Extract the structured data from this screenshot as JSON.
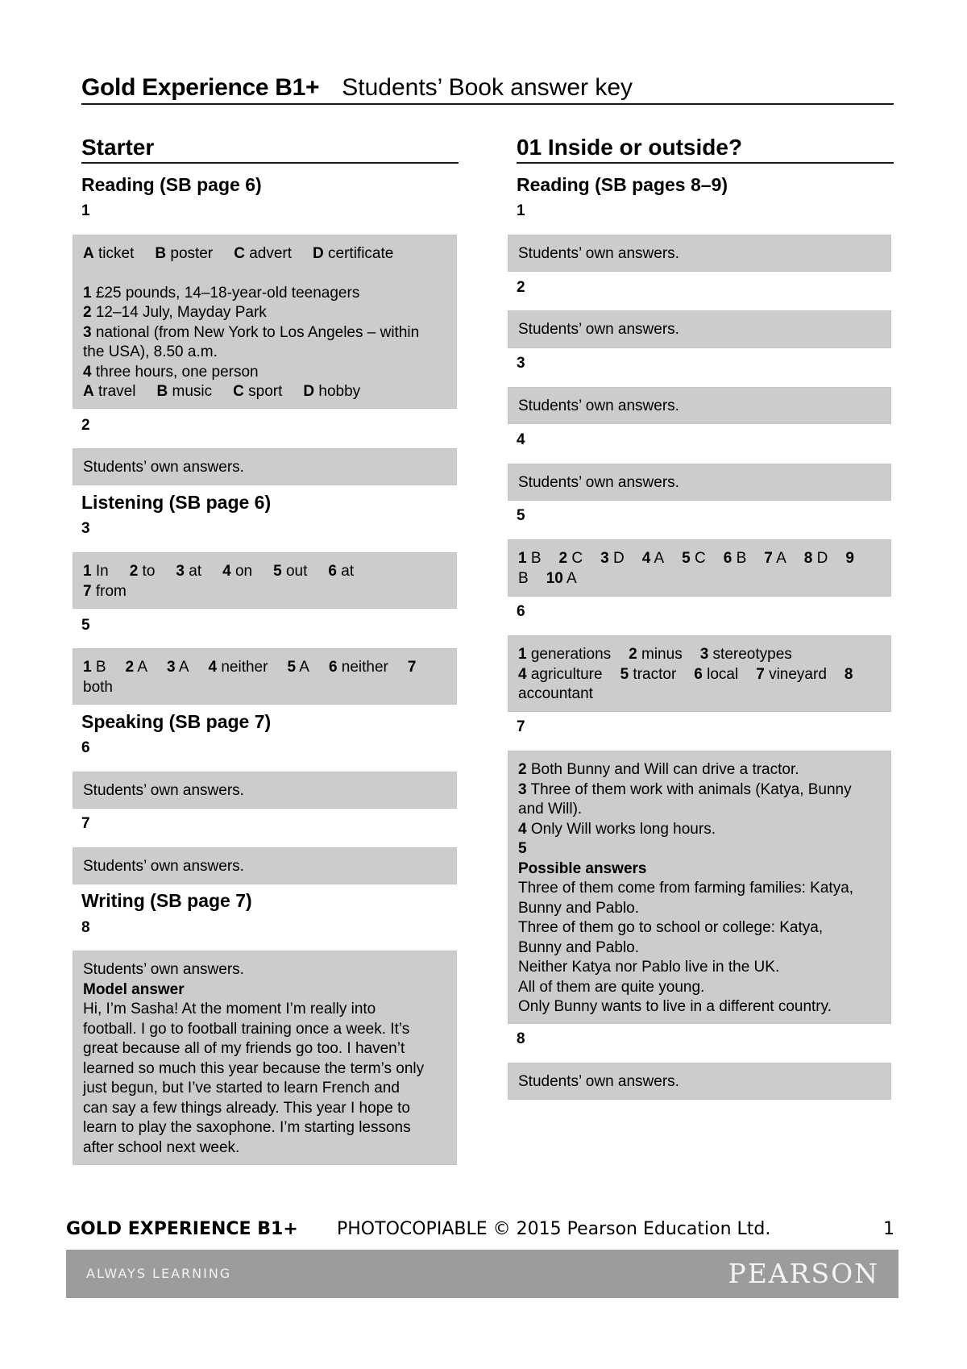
{
  "header": {
    "book": "Gold Experience B1+",
    "doc": "Students’ Book answer key"
  },
  "left": {
    "section": "Starter",
    "reading": {
      "title": "Reading (SB page 6)",
      "q1": {
        "num": "1",
        "row1": [
          [
            "A",
            "ticket"
          ],
          [
            "B",
            "poster"
          ],
          [
            "C",
            "advert"
          ],
          [
            "D",
            "certificate"
          ]
        ],
        "lines": [
          [
            "1",
            "£25 pounds, 14–18-year-old teenagers"
          ],
          [
            "2",
            "12–14 July, Mayday Park"
          ],
          [
            "3",
            "national (from New York to Los Angeles – within"
          ],
          [
            "",
            "the USA), 8.50 a.m."
          ],
          [
            "4",
            "three hours, one person"
          ]
        ],
        "row2": [
          [
            "A",
            "travel"
          ],
          [
            "B",
            "music"
          ],
          [
            "C",
            "sport"
          ],
          [
            "D",
            "hobby"
          ]
        ]
      },
      "q2": {
        "num": "2",
        "answer": "Students’ own answers."
      }
    },
    "listening": {
      "title": "Listening (SB page 6)",
      "q3": {
        "num": "3",
        "row1": [
          [
            "1",
            "In"
          ],
          [
            "2",
            "to"
          ],
          [
            "3",
            "at"
          ],
          [
            "4",
            "on"
          ],
          [
            "5",
            "out"
          ],
          [
            "6",
            "at"
          ]
        ],
        "row2": [
          [
            "7",
            "from"
          ]
        ]
      },
      "q5": {
        "num": "5",
        "row1": [
          [
            "1",
            "B"
          ],
          [
            "2",
            "A"
          ],
          [
            "3",
            "A"
          ],
          [
            "4",
            "neither"
          ],
          [
            "5",
            "A"
          ],
          [
            "6",
            "neither"
          ],
          [
            "7",
            ""
          ]
        ],
        "row2": "both"
      }
    },
    "speaking": {
      "title": "Speaking (SB page 7)",
      "q6": {
        "num": "6",
        "answer": "Students’ own answers."
      },
      "q7": {
        "num": "7",
        "answer": "Students’ own answers."
      }
    },
    "writing": {
      "title": "Writing (SB page 7)",
      "q8": {
        "num": "8",
        "answer": "Students’ own answers.",
        "model_label": "Model answer",
        "model_lines": [
          "Hi, I’m Sasha! At the moment I’m really into",
          "football. I go to football training once a week. It’s",
          "great because all of my friends go too. I haven’t",
          "learned so much this year because the term’s only",
          "just begun, but I’ve started to learn French and",
          "can say a few things already. This year I hope to",
          "learn to play the saxophone. I’m starting lessons",
          "after school next week."
        ]
      }
    }
  },
  "right": {
    "section": "01 Inside or outside?",
    "reading": {
      "title": "Reading (SB pages 8–9)",
      "q1": {
        "num": "1",
        "answer": "Students’ own answers."
      },
      "q2": {
        "num": "2",
        "answer": "Students’ own answers."
      },
      "q3": {
        "num": "3",
        "answer": "Students’ own answers."
      },
      "q4": {
        "num": "4",
        "answer": "Students’ own answers."
      },
      "q5": {
        "num": "5",
        "row1": [
          [
            "1",
            "B"
          ],
          [
            "2",
            "C"
          ],
          [
            "3",
            "D"
          ],
          [
            "4",
            "A"
          ],
          [
            "5",
            "C"
          ],
          [
            "6",
            "B"
          ],
          [
            "7",
            "A"
          ],
          [
            "8",
            "D"
          ],
          [
            "9",
            ""
          ]
        ],
        "row2": [
          [
            "",
            "B"
          ],
          [
            "10",
            "A"
          ]
        ]
      },
      "q6": {
        "num": "6",
        "row1": [
          [
            "1",
            "generations"
          ],
          [
            "2",
            "minus"
          ],
          [
            "3",
            "stereotypes"
          ]
        ],
        "row2": [
          [
            "4",
            "agriculture"
          ],
          [
            "5",
            "tractor"
          ],
          [
            "6",
            "local"
          ],
          [
            "7",
            "vineyard"
          ],
          [
            "8",
            ""
          ]
        ],
        "row3": "accountant"
      },
      "q7": {
        "num": "7",
        "lines": [
          [
            "2",
            "Both Bunny and Will can drive a tractor."
          ],
          [
            "3",
            "Three of them work with animals (Katya, Bunny"
          ],
          [
            "",
            "and Will)."
          ],
          [
            "4",
            "Only Will works long hours."
          ],
          [
            "5",
            ""
          ]
        ],
        "possible_label": "Possible answers",
        "possible_lines": [
          "Three of them come from farming families: Katya,",
          "Bunny and Pablo.",
          "Three of them go to school or college: Katya,",
          "Bunny and Pablo.",
          "Neither Katya nor Pablo live in the UK.",
          "All of them are quite young.",
          "Only Bunny wants to live in a different country."
        ]
      },
      "q8": {
        "num": "8",
        "answer": "Students’ own answers."
      }
    }
  },
  "footer": {
    "book": "GOLD EXPERIENCE B1+",
    "copyright": "PHOTOCOPIABLE © 2015 Pearson Education Ltd.",
    "page": "1",
    "tagline": "ALWAYS LEARNING",
    "brand": "PEARSON"
  },
  "colors": {
    "answer_box": "#cccccc",
    "footer_band": "#9c9c9c",
    "text": "#000000"
  }
}
